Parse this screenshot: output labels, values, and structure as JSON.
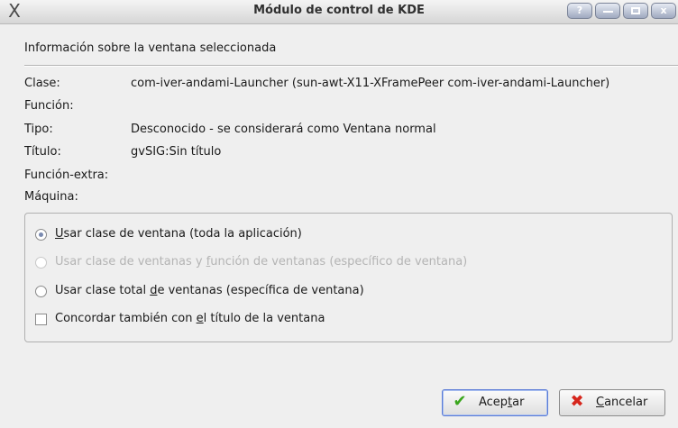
{
  "window": {
    "title": "Módulo de control de KDE",
    "buttons": {
      "help": "?",
      "minimize": "",
      "maximize": "",
      "close": "x"
    }
  },
  "heading": "Información sobre la ventana seleccionada",
  "info": [
    {
      "label": "Clase:",
      "value": "com-iver-andami-Launcher (sun-awt-X11-XFramePeer com-iver-andami-Launcher)"
    },
    {
      "label": "Función:",
      "value": ""
    },
    {
      "label": "Tipo:",
      "value": "Desconocido - se considerará como Ventana normal"
    },
    {
      "label": "Título:",
      "value": "gvSIG:Sin título"
    },
    {
      "label": "Función-extra:",
      "value": ""
    },
    {
      "label": "Máquina:",
      "value": ""
    }
  ],
  "options": {
    "opt1": {
      "pre": "",
      "u": "U",
      "post": "sar clase de ventana (toda la aplicación)",
      "checked": true,
      "enabled": true
    },
    "opt2": {
      "pre": "Usar clase de ventanas y ",
      "u": "f",
      "post": "unción de ventanas (específico de ventana)",
      "checked": false,
      "enabled": false
    },
    "opt3": {
      "pre": "Usar clase total ",
      "u": "d",
      "post": "e ventanas (específica de ventana)",
      "checked": false,
      "enabled": true
    },
    "opt4": {
      "pre": "Concordar también con ",
      "u": "e",
      "post": "l título de la ventana",
      "checked": false,
      "enabled": true
    }
  },
  "buttons": {
    "ok": {
      "pre": "Acep",
      "u": "t",
      "post": "ar",
      "icon": "check-icon",
      "icon_color": "#3aa61d"
    },
    "cancel": {
      "pre": "",
      "u": "C",
      "post": "ancelar",
      "icon": "cross-icon",
      "icon_color": "#d6261c"
    }
  }
}
